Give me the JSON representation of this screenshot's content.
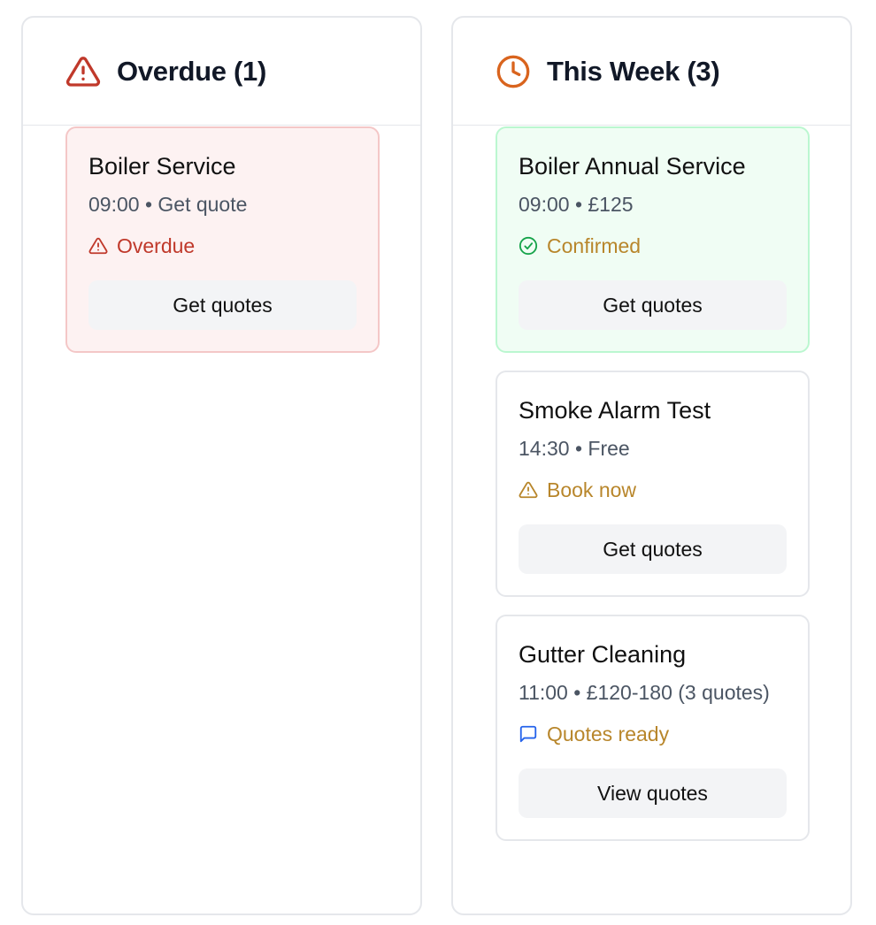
{
  "columns": [
    {
      "title": "Overdue (1)",
      "icon": "warning-triangle-icon",
      "accent": "#c0392b",
      "cards": [
        {
          "title": "Boiler Service",
          "meta": "09:00 • Get quote",
          "status": "Overdue",
          "status_icon": "warning-triangle-icon",
          "status_color": "#c0392b",
          "button": "Get quotes"
        }
      ]
    },
    {
      "title": "This Week (3)",
      "icon": "clock-icon",
      "accent": "#d9641e",
      "cards": [
        {
          "title": "Boiler Annual Service",
          "meta": "09:00 • £125",
          "status": "Confirmed",
          "status_icon": "check-circle-icon",
          "status_color": "#b8862b",
          "button": "Get quotes"
        },
        {
          "title": "Smoke Alarm Test",
          "meta": "14:30 • Free",
          "status": "Book now",
          "status_icon": "warning-triangle-icon",
          "status_color": "#b8862b",
          "button": "Get quotes"
        },
        {
          "title": "Gutter Cleaning",
          "meta": "11:00 • £120-180 (3 quotes)",
          "status": "Quotes ready",
          "status_icon": "message-square-icon",
          "status_color": "#b8862b",
          "button": "View quotes"
        }
      ]
    }
  ],
  "colors": {
    "overdue_card_bg": "#fdf2f2",
    "overdue_card_border": "#f4c7c7",
    "confirmed_card_bg": "#f0fdf4",
    "confirmed_card_border": "#bbf7d0",
    "button_bg": "#f3f4f6",
    "message_icon": "#2563eb",
    "confirmed_icon": "#16a34a"
  }
}
